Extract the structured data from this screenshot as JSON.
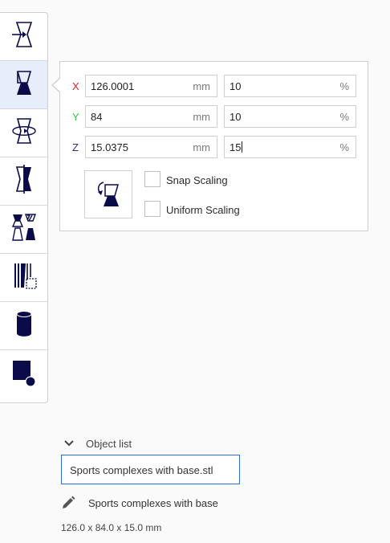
{
  "toolbar": {
    "tools": [
      {
        "name": "move-tool-icon"
      },
      {
        "name": "scale-tool-icon"
      },
      {
        "name": "rotate-tool-icon"
      },
      {
        "name": "mirror-tool-icon"
      },
      {
        "name": "per-model-settings-icon"
      },
      {
        "name": "support-blocker-icon"
      },
      {
        "name": "cylinder-icon"
      },
      {
        "name": "shape-icon"
      }
    ]
  },
  "scale_panel": {
    "axes": [
      {
        "label": "X",
        "color": "#e02020",
        "mm": "126.0001",
        "percent": "10"
      },
      {
        "label": "Y",
        "color": "#2ecc40",
        "mm": "84",
        "percent": "10"
      },
      {
        "label": "Z",
        "color": "#2e2e6e",
        "mm": "15.0375",
        "percent": "15"
      }
    ],
    "mm_unit": "mm",
    "percent_unit": "%",
    "snap_scaling_label": "Snap Scaling",
    "uniform_scaling_label": "Uniform Scaling"
  },
  "object_list": {
    "title": "Object list",
    "selected_file": "Sports complexes with base.stl",
    "object_name": "Sports complexes with base",
    "dimensions": "126.0 x 84.0 x 15.0 mm"
  },
  "colors": {
    "accent": "#2a6fd6",
    "icon_dark": "#0b0b4a",
    "active_tool_bg": "#e6eefc"
  }
}
